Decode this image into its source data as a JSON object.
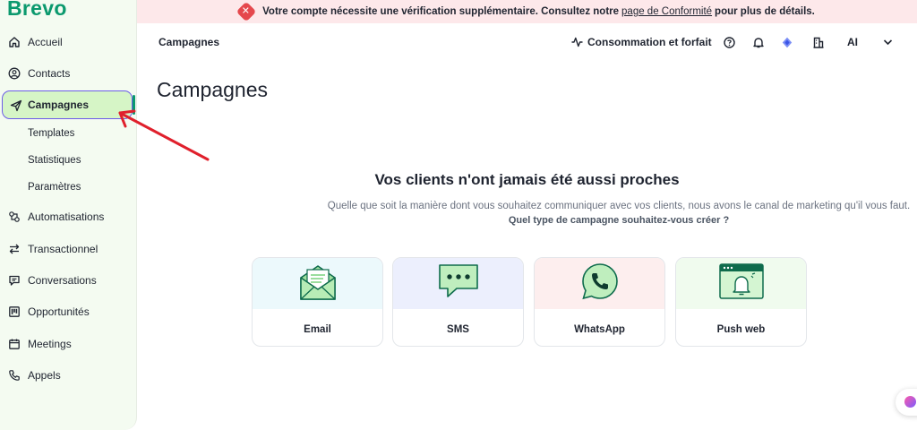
{
  "app": {
    "logo": "Brevo"
  },
  "sidebar": {
    "items": [
      {
        "label": "Accueil",
        "icon": "home-icon"
      },
      {
        "label": "Contacts",
        "icon": "contacts-icon"
      },
      {
        "label": "Campagnes",
        "icon": "send-icon",
        "active": true
      },
      {
        "label": "Automatisations",
        "icon": "automation-icon"
      },
      {
        "label": "Transactionnel",
        "icon": "transactional-icon"
      },
      {
        "label": "Conversations",
        "icon": "chat-icon"
      },
      {
        "label": "Opportunités",
        "icon": "pipeline-icon"
      },
      {
        "label": "Meetings",
        "icon": "calendar-icon"
      },
      {
        "label": "Appels",
        "icon": "phone-icon"
      }
    ],
    "subitems": [
      {
        "label": "Templates"
      },
      {
        "label": "Statistiques"
      },
      {
        "label": "Paramètres"
      }
    ]
  },
  "banner": {
    "text_before": "Votre compte nécessite une vérification supplémentaire. Consultez notre",
    "link": "page de Conformité",
    "text_after": "pour plus de détails."
  },
  "topbar": {
    "title": "Campagnes",
    "usage_label": "Consommation et forfait",
    "avatar_initials": "AI"
  },
  "main": {
    "title": "Campagnes",
    "hero_title": "Vos clients n'ont jamais été aussi proches",
    "hero_subtitle": "Quelle que soit la manière dont vous souhaitez communiquer avec vos clients, nous avons le canal de marketing qu'il vous faut.",
    "hero_question": "Quel type de campagne souhaitez-vous créer ?",
    "cards": [
      {
        "label": "Email",
        "icon": "envelope-icon",
        "bg": "#ecf9fc"
      },
      {
        "label": "SMS",
        "icon": "sms-bubble-icon",
        "bg": "#eceffd"
      },
      {
        "label": "WhatsApp",
        "icon": "whatsapp-icon",
        "bg": "#fdeeee"
      },
      {
        "label": "Push web",
        "icon": "browser-bell-icon",
        "bg": "#f0fbee"
      }
    ]
  },
  "colors": {
    "brand": "#0b996e",
    "active_bg": "#d6f5c6",
    "active_border": "#6d5ce8",
    "banner_bg": "#fde8ea",
    "arrow": "#e0202c"
  }
}
